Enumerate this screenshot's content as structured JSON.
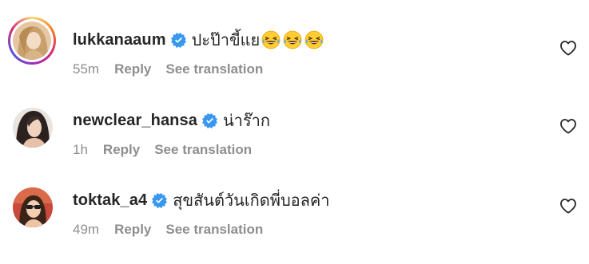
{
  "comments": [
    {
      "username": "lukkanaaum",
      "verified": true,
      "text": "ปะป๊าขี้แย",
      "emojis": [
        "grinning-squinting-tears-emoji",
        "grinning-squinting-tears-emoji",
        "grinning-squinting-tears-emoji"
      ],
      "time": "55m",
      "reply_label": "Reply",
      "translate_label": "See translation",
      "has_story_ring": true
    },
    {
      "username": "newclear_hansa",
      "verified": true,
      "text": "น่าร๊าก",
      "emojis": [],
      "time": "1h",
      "reply_label": "Reply",
      "translate_label": "See translation",
      "has_story_ring": false
    },
    {
      "username": "toktak_a4",
      "verified": true,
      "text": "สุขสันต์วันเกิดพี่บอลค่า",
      "emojis": [],
      "time": "49m",
      "reply_label": "Reply",
      "translate_label": "See translation",
      "has_story_ring": false
    }
  ],
  "icons": {
    "verified": "verified-badge-icon",
    "like": "heart-outline-icon"
  },
  "colors": {
    "verified_blue": "#3897f0",
    "secondary_text": "#8e8e8e",
    "primary_text": "#262626"
  }
}
